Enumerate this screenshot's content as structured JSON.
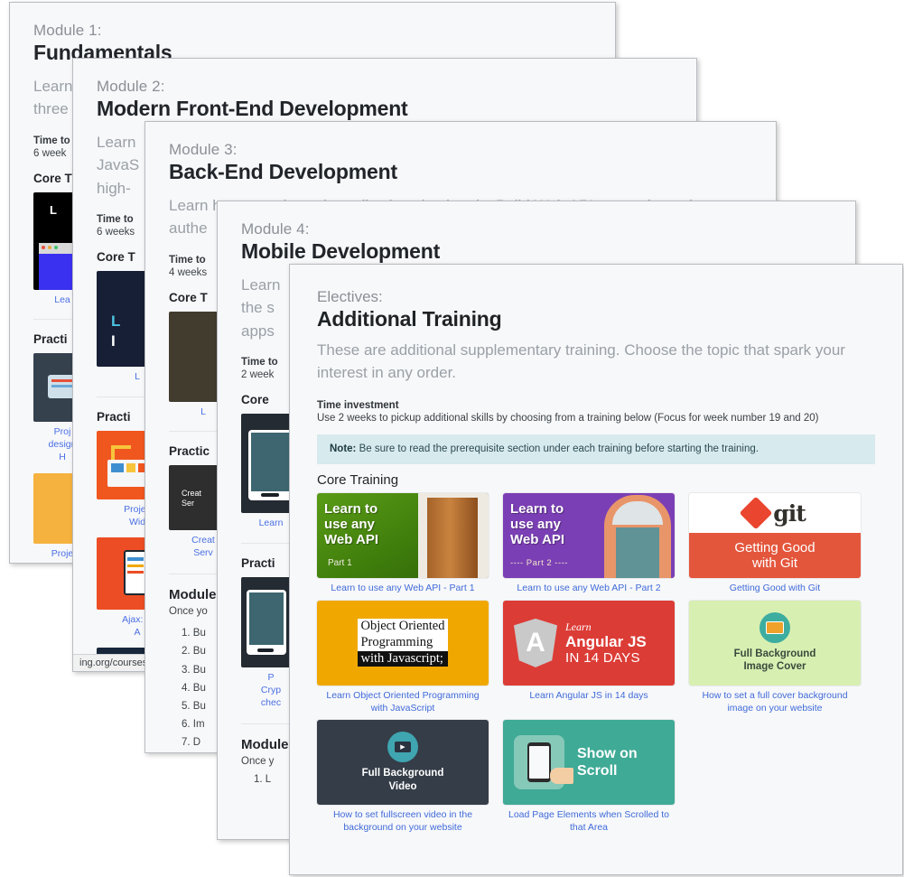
{
  "modules": [
    {
      "kicker": "Module 1:",
      "title": "Fundamentals",
      "desc_line1": "Learn",
      "desc_line2": "three",
      "time_label": "Time to",
      "time_value": "6 week",
      "core_head": "Core T",
      "practice_head": "Practi",
      "thumbs": [
        {
          "caption": "Lea"
        },
        {
          "caption": "Proj\ndesign\nH"
        },
        {
          "caption": "Proje\nSn"
        }
      ]
    },
    {
      "kicker": "Module 2:",
      "title": "Modern Front-End Development",
      "desc_line1": "Learn",
      "desc_line2": "JavaS",
      "desc_line3": "high-",
      "time_label": "Time to",
      "time_value": "6 weeks",
      "core_head": "Core T",
      "practice_head": "Practi",
      "status_url": "ing.org/courses",
      "thumbs": [
        {
          "caption": "L"
        },
        {
          "caption": "Projec\nWid"
        },
        {
          "caption": "Ajax: C\nA"
        }
      ]
    },
    {
      "kicker": "Module 3:",
      "title": "Back-End Development",
      "desc_line1": "Learn how to make web applications backends. Build Web APIs, security and",
      "desc_line2": "authe",
      "time_label": "Time to",
      "time_value": "4 weeks",
      "core_head": "Core T",
      "practice_head": "Practic",
      "module_head": "Module",
      "module_intro": "Once yo",
      "list": [
        "1. Bu",
        "2. Bu",
        "3. Bu",
        "4. Bu",
        "5. Bu",
        "6. Im",
        "7. D"
      ],
      "thumbs": [
        {
          "caption": "L"
        },
        {
          "caption": "Creat\nServ"
        }
      ],
      "thumb_inner_text": "Creat\nSer"
    },
    {
      "kicker": "Module 4:",
      "title": "Mobile Development",
      "desc_line1": "Learn",
      "desc_line2": "the s",
      "desc_line3": "apps",
      "time_label": "Time to",
      "time_value": "2 week",
      "core_head": "Core",
      "practice_head": "Practi",
      "module_head": "Module",
      "module_intro": "Once y",
      "list": [
        "1. L"
      ],
      "thumbs": [
        {
          "caption": "Learn"
        },
        {
          "caption": "P\nCryp\nchec"
        }
      ]
    }
  ],
  "electives": {
    "kicker": "Electives:",
    "title": "Additional Training",
    "description": "These are additional supplementary training. Choose the topic that spark your interest in any order.",
    "time_label": "Time investment",
    "time_value": "Use 2 weeks to pickup additional skills by choosing from a training below (Focus for week number 19 and 20)",
    "note_prefix": "Note:",
    "note_text": "Be sure to read the prerequisite section under each training before starting the training.",
    "core_training_head": "Core Training",
    "tiles": [
      {
        "caption": "Learn to use any Web API - Part 1",
        "art_line1": "Learn to",
        "art_line2": "use any",
        "art_line3": "Web API",
        "art_sub": "Part 1",
        "color": "#3f7d0c"
      },
      {
        "caption": "Learn to use any Web API - Part 2",
        "art_line1": "Learn to",
        "art_line2": "use any",
        "art_line3": "Web API",
        "art_sub": "---- Part 2 ----",
        "color": "#7b3fb5"
      },
      {
        "caption": "Getting Good with Git",
        "art_word": "git",
        "art_line1": "Getting Good",
        "art_line2": "with Git",
        "color": "#e4563c"
      },
      {
        "caption": "Learn Object Oriented Programming with JavaScript",
        "art_line1": "Object Oriented",
        "art_line2": "Programming",
        "art_line3": "with Javascript;",
        "color": "#f0a800"
      },
      {
        "caption": "Learn Angular JS in 14 days",
        "art_letter": "A",
        "art_learn": "Learn",
        "art_line1": "Angular JS",
        "art_line2": "IN 14 DAYS",
        "color": "#dc3c36"
      },
      {
        "caption": "How to set a full cover background image on your website",
        "art_line1": "Full Background",
        "art_line2": "Image Cover",
        "color": "#d8efb2"
      },
      {
        "caption": "How to set fullscreen video in the background on your website",
        "art_line1": "Full Background",
        "art_line2": "Video",
        "color": "#353d48"
      },
      {
        "caption": "Load Page Elements when Scrolled to that Area",
        "art_line1": "Show on",
        "art_line2": "Scroll",
        "color": "#3faa96"
      }
    ]
  },
  "colors": {
    "card_bg": "#f7f8fa",
    "link": "#3f6ad8",
    "note_bg": "#d7eaee",
    "muted_text": "#9aa0a6"
  }
}
